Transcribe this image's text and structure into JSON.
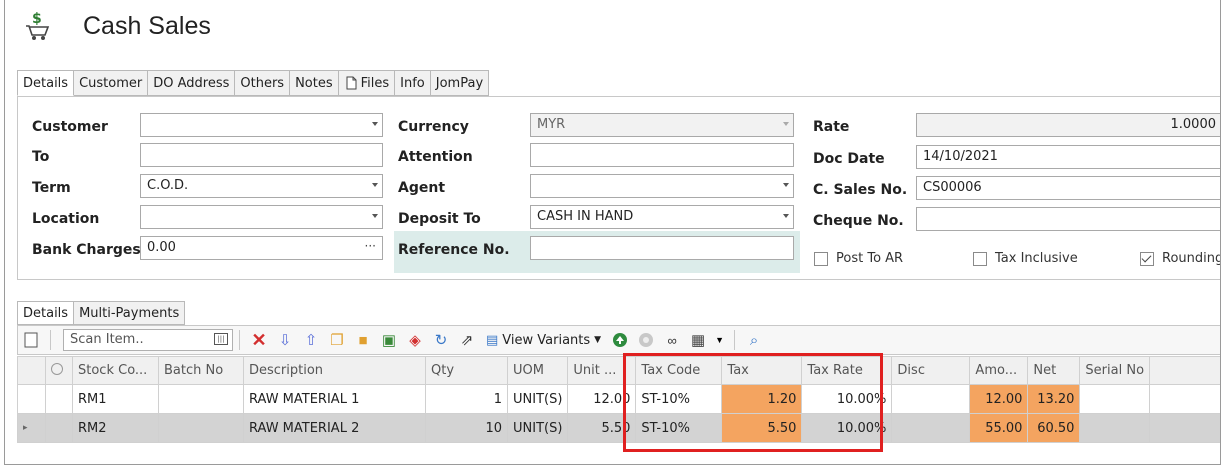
{
  "window": {
    "title": "Cash Sales"
  },
  "top_tabs": [
    "Details",
    "Customer",
    "DO Address",
    "Others",
    "Notes",
    "Files",
    "Info",
    "JomPay"
  ],
  "form": {
    "customer_label": "Customer",
    "customer_value": "",
    "to_label": "To",
    "to_value": "",
    "term_label": "Term",
    "term_value": "C.O.D.",
    "location_label": "Location",
    "location_value": "",
    "bank_charges_label": "Bank Charges",
    "bank_charges_value": "0.00",
    "currency_label": "Currency",
    "currency_value": "MYR",
    "attention_label": "Attention",
    "attention_value": "",
    "agent_label": "Agent",
    "agent_value": "",
    "deposit_to_label": "Deposit To",
    "deposit_to_value": "CASH IN HAND",
    "reference_label": "Reference No.",
    "reference_value": "",
    "rate_label": "Rate",
    "rate_value": "1.0000",
    "doc_date_label": "Doc Date",
    "doc_date_value": "14/10/2021",
    "sales_no_label": "C. Sales No.",
    "sales_no_value": "CS00006",
    "cheque_label": "Cheque No.",
    "cheque_value": "",
    "post_to_ar_label": "Post To AR",
    "post_to_ar_checked": false,
    "tax_inclusive_label": "Tax Inclusive",
    "tax_inclusive_checked": false,
    "rounding_label": "Rounding",
    "rounding_checked": true
  },
  "lower_tabs": [
    "Details",
    "Multi-Payments"
  ],
  "toolbar": {
    "scan_placeholder": "Scan Item..",
    "view_variants_label": "View Variants"
  },
  "grid": {
    "columns": [
      "",
      "Stock Co...",
      "Batch No",
      "Description",
      "Qty",
      "UOM",
      "Unit ...",
      "Tax Code",
      "Tax",
      "Tax Rate",
      "Disc",
      "Amo...",
      "Net",
      "Serial No"
    ],
    "rows": [
      {
        "stock_code": "RM1",
        "batch_no": "",
        "description": "RAW MATERIAL 1",
        "qty": "1",
        "uom": "UNIT(S)",
        "unit_price": "12.00",
        "tax_code": "ST-10%",
        "tax": "1.20",
        "tax_rate": "10.00%",
        "disc": "",
        "amount": "12.00",
        "net": "13.20",
        "serial_no": ""
      },
      {
        "stock_code": "RM2",
        "batch_no": "",
        "description": "RAW MATERIAL 2",
        "qty": "10",
        "uom": "UNIT(S)",
        "unit_price": "5.50",
        "tax_code": "ST-10%",
        "tax": "5.50",
        "tax_rate": "10.00%",
        "disc": "",
        "amount": "55.00",
        "net": "60.50",
        "serial_no": ""
      }
    ]
  },
  "colors": {
    "highlight_cell": "#f4a460",
    "annotation_box": "#e02020",
    "reference_bg": "#dcecea"
  }
}
